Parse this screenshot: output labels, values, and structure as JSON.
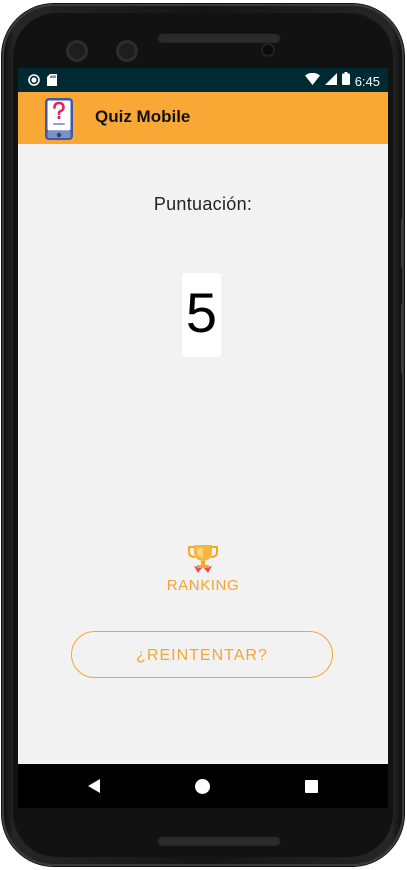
{
  "app": {
    "title": "Quiz Mobile",
    "icon": "quiz-phone-icon"
  },
  "statusbar": {
    "time": "6:45",
    "icons": [
      "record-dot-icon",
      "sd-card-icon",
      "wifi-icon",
      "signal-icon",
      "battery-icon"
    ]
  },
  "score": {
    "label": "Puntuación:",
    "value": "5"
  },
  "ranking": {
    "label": "RANKING",
    "icon": "trophy-icon"
  },
  "retry": {
    "label": "¿REINTENTAR?"
  },
  "navbar": {
    "icons": [
      "back-icon",
      "home-icon",
      "recent-apps-icon"
    ]
  },
  "colors": {
    "accent": "#f9a835",
    "accent_text": "#f3a733",
    "statusbar": "#002a33",
    "background": "#f2f2f2"
  }
}
